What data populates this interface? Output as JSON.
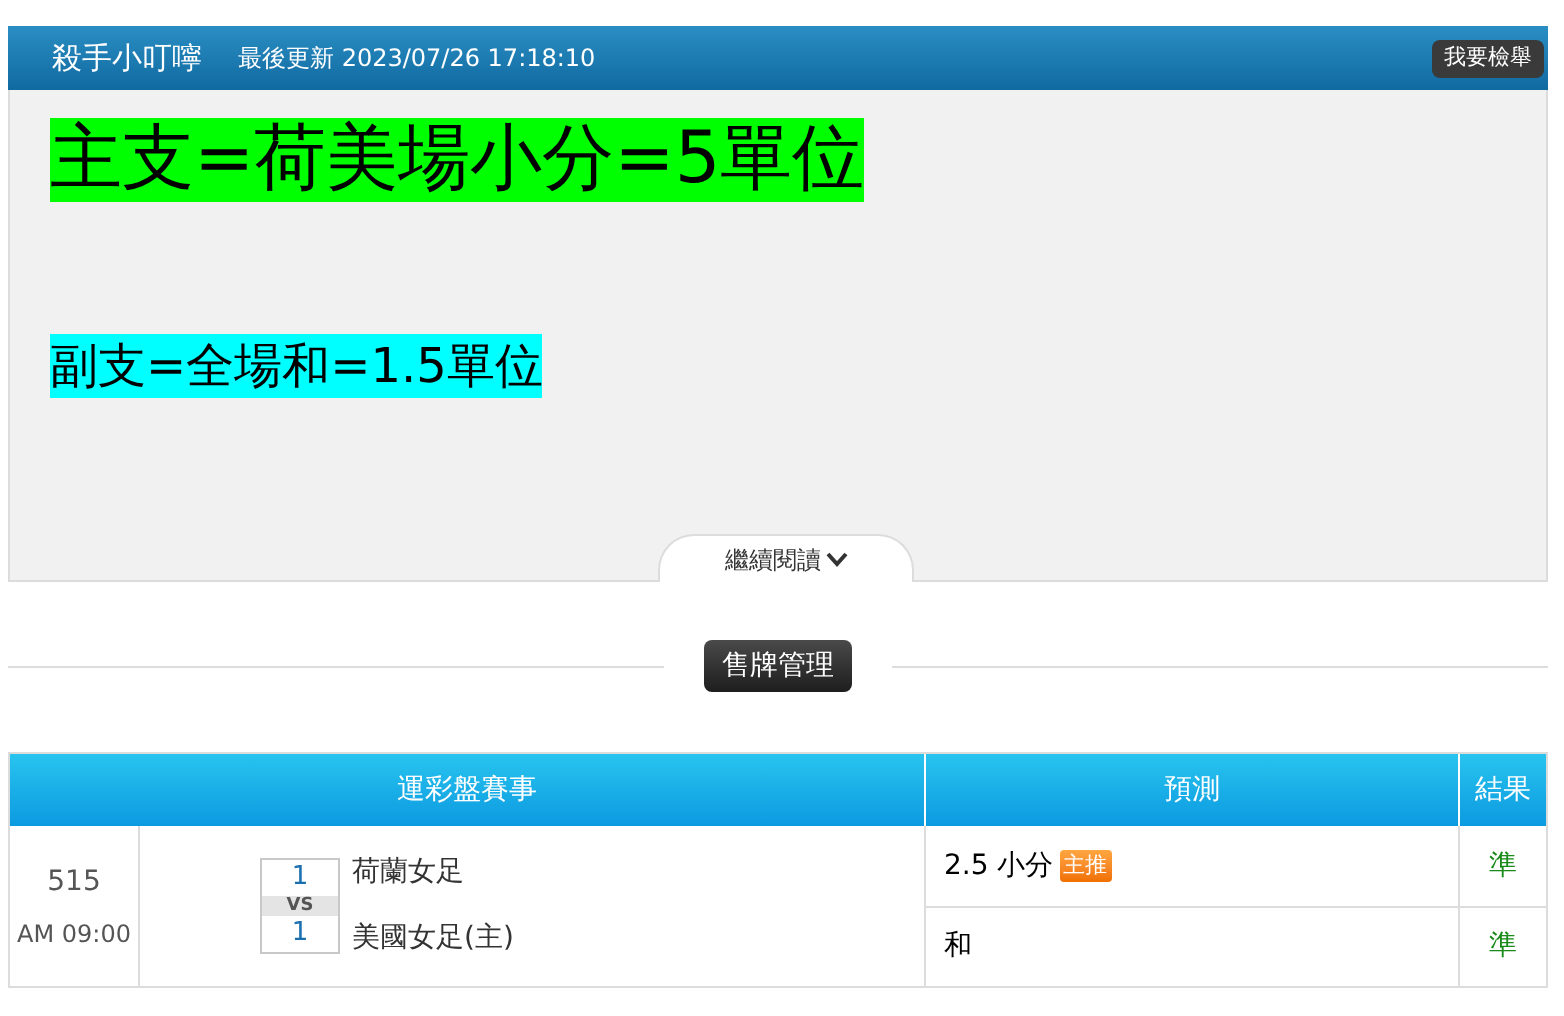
{
  "header": {
    "title": "殺手小叮嚀",
    "updated": "最後更新 2023/07/26 17:18:10",
    "report_button": "我要檢舉"
  },
  "article": {
    "lines": [
      {
        "text": "主支=荷美場小分=5單位",
        "color": "#00ff00",
        "kind": "large"
      },
      {
        "text": "副支=全場和=1.5單位",
        "color": "#00ffff",
        "kind": "medium"
      }
    ],
    "read_more": "繼續閱讀"
  },
  "section_button": "售牌管理",
  "table": {
    "columns": [
      "運彩盤賽事",
      "預測",
      "結果"
    ],
    "rows": [
      {
        "number": "515",
        "time": "AM 09:00",
        "teams": [
          {
            "score": "1",
            "name": "荷蘭女足"
          },
          {
            "score": "1",
            "name": "美國女足(主)"
          }
        ],
        "vs": "VS",
        "predictions": [
          {
            "pick": "2.5 小分",
            "tag": "主推",
            "result": "準"
          },
          {
            "pick": "和",
            "result": "準"
          }
        ]
      }
    ]
  }
}
